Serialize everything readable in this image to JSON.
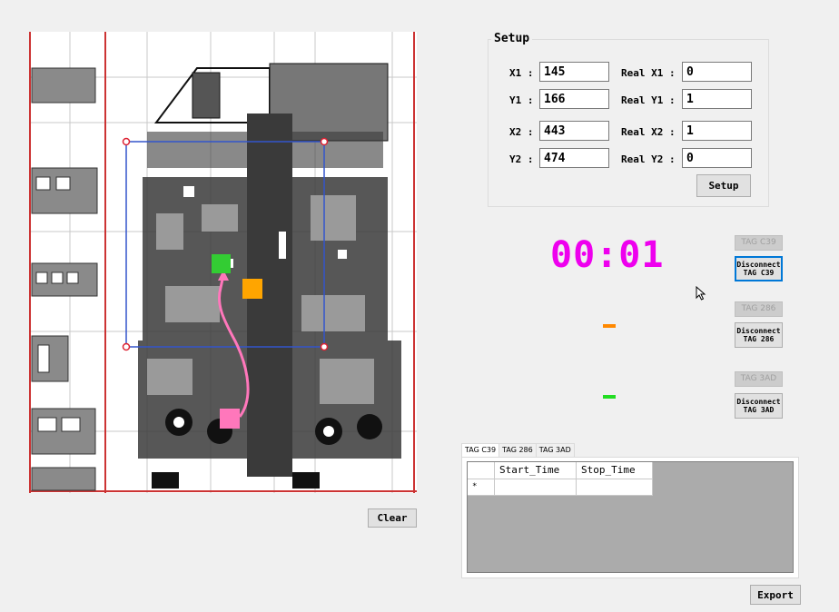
{
  "setup": {
    "title": "Setup",
    "fields": [
      {
        "label": "X1 :",
        "value": "145"
      },
      {
        "label": "Y1 :",
        "value": "166"
      },
      {
        "label": "X2 :",
        "value": "443"
      },
      {
        "label": "Y2 :",
        "value": "474"
      }
    ],
    "real_fields": [
      {
        "label": "Real X1 :",
        "value": "0"
      },
      {
        "label": "Real Y1 :",
        "value": "1"
      },
      {
        "label": "Real X2 :",
        "value": "1"
      },
      {
        "label": "Real Y2 :",
        "value": "0"
      }
    ],
    "button": "Setup"
  },
  "timer": "00:01",
  "tags": [
    {
      "name": "TAG C39",
      "disconnect": "Disconnect\nTAG C39",
      "color": "#22cc22"
    },
    {
      "name": "TAG 286",
      "disconnect": "Disconnect\nTAG 286",
      "color": "#ff8800"
    },
    {
      "name": "TAG 3AD",
      "disconnect": "Disconnect\nTAG 3AD",
      "color": "#22cc22"
    }
  ],
  "dash_colors": {
    "first": "#ff8800",
    "second": "#22dd22"
  },
  "markers": {
    "green": "#33cc33",
    "orange": "#ffa500",
    "pink": "#ff77bb",
    "path": "#ff77bb",
    "roi": "#3355cc",
    "roi_corner": "#dd2233"
  },
  "clear_button": "Clear",
  "export_button": "Export",
  "table": {
    "tabs": [
      "TAG C39",
      "TAG 286",
      "TAG 3AD"
    ],
    "columns": [
      "Start_Time",
      "Stop_Time"
    ],
    "new_row_marker": "*"
  }
}
